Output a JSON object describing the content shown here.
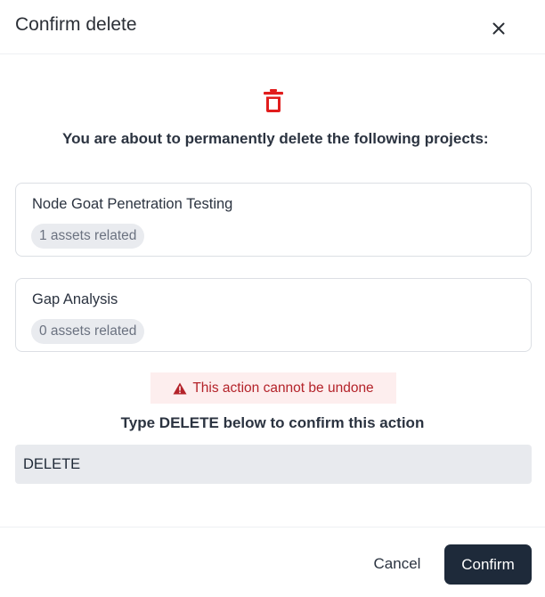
{
  "dialog": {
    "title": "Confirm delete",
    "close_icon": "close-icon"
  },
  "body": {
    "icon": "trash-icon",
    "icon_color": "#e11d1d",
    "message": "You are about to permanently delete the following projects:",
    "projects": [
      {
        "name": "Node Goat Penetration Testing",
        "assets": "1 assets related"
      },
      {
        "name": "Gap Analysis",
        "assets": "0 assets related"
      }
    ],
    "warning": {
      "icon": "warning-icon",
      "text": "This action cannot be undone",
      "color": "#b4232a"
    },
    "confirm_prompt": "Type DELETE below to confirm this action",
    "confirm_input_value": "DELETE"
  },
  "footer": {
    "cancel_label": "Cancel",
    "confirm_label": "Confirm",
    "confirm_bg": "#1e2a3a"
  }
}
